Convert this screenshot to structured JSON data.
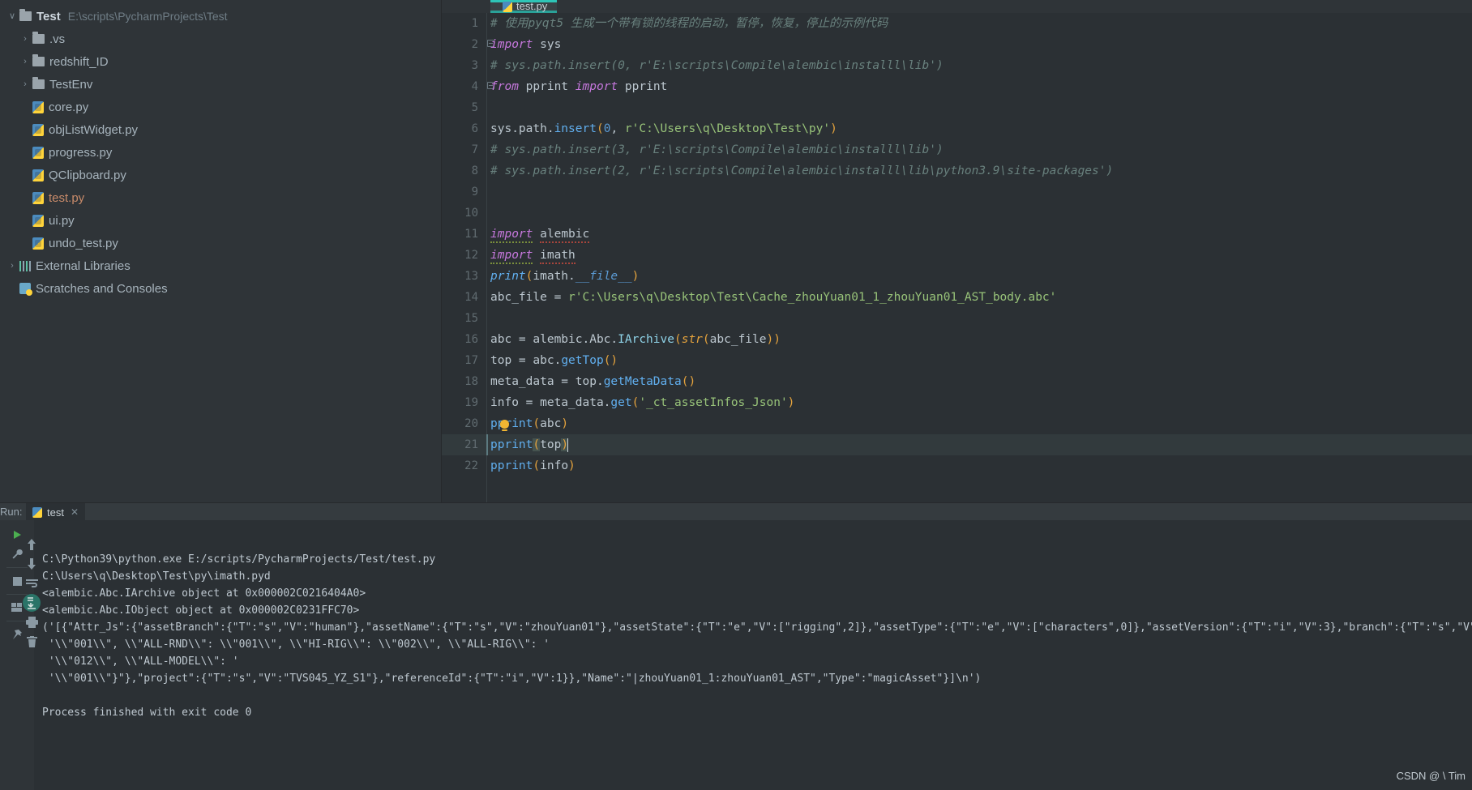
{
  "sidebar": {
    "items": [
      {
        "arrow": "v",
        "icon": "folder-icon",
        "label": "Test",
        "path": "E:\\scripts\\PycharmProjects\\Test",
        "bold": true,
        "indent": 0
      },
      {
        "arrow": ">",
        "icon": "folder-icon",
        "label": ".vs",
        "path": "",
        "bold": false,
        "indent": 1
      },
      {
        "arrow": ">",
        "icon": "folder-icon",
        "label": "redshift_ID",
        "path": "",
        "bold": false,
        "indent": 1
      },
      {
        "arrow": ">",
        "icon": "folder-icon",
        "label": "TestEnv",
        "path": "",
        "bold": false,
        "indent": 1
      },
      {
        "arrow": "",
        "icon": "python-file-icon",
        "label": "core.py",
        "path": "",
        "bold": false,
        "indent": 1
      },
      {
        "arrow": "",
        "icon": "python-file-icon",
        "label": "objListWidget.py",
        "path": "",
        "bold": false,
        "indent": 1
      },
      {
        "arrow": "",
        "icon": "python-file-icon",
        "label": "progress.py",
        "path": "",
        "bold": false,
        "indent": 1
      },
      {
        "arrow": "",
        "icon": "python-file-icon",
        "label": "QClipboard.py",
        "path": "",
        "bold": false,
        "indent": 1
      },
      {
        "arrow": "",
        "icon": "python-file-icon",
        "label": "test.py",
        "path": "",
        "bold": false,
        "indent": 1,
        "highlight": true
      },
      {
        "arrow": "",
        "icon": "python-file-icon",
        "label": "ui.py",
        "path": "",
        "bold": false,
        "indent": 1
      },
      {
        "arrow": "",
        "icon": "python-file-icon",
        "label": "undo_test.py",
        "path": "",
        "bold": false,
        "indent": 1
      },
      {
        "arrow": ">",
        "icon": "external-libraries-icon",
        "label": "External Libraries",
        "path": "",
        "bold": false,
        "indent": 0
      },
      {
        "arrow": "",
        "icon": "scratches-icon",
        "label": "Scratches and Consoles",
        "path": "",
        "bold": false,
        "indent": 0
      }
    ]
  },
  "editor": {
    "tab": {
      "label": "test.py",
      "icon": "python-file-icon"
    },
    "lines": [
      {
        "n": "1",
        "fold": false,
        "html": "<span class='t-cmt'># 使用pyqt5 生成一个带有锁的线程的启动，暂停，恢复，停止的示例代码</span>"
      },
      {
        "n": "2",
        "fold": true,
        "html": "<span class='t-imp'>import</span> <span class='t-plain'>sys</span>"
      },
      {
        "n": "3",
        "fold": false,
        "html": "<span class='t-cmt'># sys.path.insert(0, r'E:\\scripts\\Compile\\alembic\\installl\\lib')</span>"
      },
      {
        "n": "4",
        "fold": true,
        "html": "<span class='t-imp'>from</span> <span class='t-plain'>pprint</span> <span class='t-imp'>import</span> <span class='t-plain'>pprint</span>"
      },
      {
        "n": "5",
        "fold": false,
        "html": ""
      },
      {
        "n": "6",
        "fold": false,
        "html": "<span class='t-plain'>sys.path.</span><span class='t-meth'>insert</span><span class='t-paren'>(</span><span class='t-num'>0</span><span class='t-plain'>, </span><span class='t-str2'>r'C:\\Users\\q\\Desktop\\Test\\py'</span><span class='t-paren'>)</span>"
      },
      {
        "n": "7",
        "fold": false,
        "html": "<span class='t-cmt'># sys.path.insert(3, r'E:\\scripts\\Compile\\alembic\\installl\\lib')</span>"
      },
      {
        "n": "8",
        "fold": false,
        "html": "<span class='t-cmt'># sys.path.insert(2, r'E:\\scripts\\Compile\\alembic\\installl\\lib\\python3.9\\site-packages')</span>"
      },
      {
        "n": "9",
        "fold": false,
        "html": ""
      },
      {
        "n": "10",
        "fold": false,
        "html": ""
      },
      {
        "n": "11",
        "fold": false,
        "html": "<span class='t-imp squig-g'>import</span> <span class='t-plain squig-r'>alembic</span>"
      },
      {
        "n": "12",
        "fold": false,
        "html": "<span class='t-imp squig-g'>import</span> <span class='t-plain squig-r'>imath</span>"
      },
      {
        "n": "13",
        "fold": false,
        "html": "<span class='t-fn'>print</span><span class='t-paren'>(</span><span class='t-plain'>imath.</span><span class='t-dunder'>__file__</span><span class='t-paren'>)</span>"
      },
      {
        "n": "14",
        "fold": false,
        "html": "<span class='t-plain'>abc_file = </span><span class='t-str2'>r'C:\\Users\\q\\Desktop\\Test\\Cache_zhouYuan01_1_zhouYuan01_AST_body.abc'</span>"
      },
      {
        "n": "15",
        "fold": false,
        "html": ""
      },
      {
        "n": "16",
        "fold": false,
        "html": "<span class='t-plain'>abc = alembic.Abc.</span><span class='t-cls'>IArchive</span><span class='t-paren'>(</span><span class='t-builtin'>str</span><span class='t-paren'>(</span><span class='t-plain'>abc_file</span><span class='t-paren'>))</span>"
      },
      {
        "n": "17",
        "fold": false,
        "html": "<span class='t-plain'>top = abc.</span><span class='t-meth'>getTop</span><span class='t-paren'>()</span>"
      },
      {
        "n": "18",
        "fold": false,
        "html": "<span class='t-plain'>meta_data = top.</span><span class='t-meth'>getMetaData</span><span class='t-paren'>()</span>"
      },
      {
        "n": "19",
        "fold": false,
        "html": "<span class='t-plain'>info = meta_data.</span><span class='t-meth'>get</span><span class='t-paren'>(</span><span class='t-str2'>'_ct_assetInfos_Json'</span><span class='t-paren'>)</span>"
      },
      {
        "n": "20",
        "fold": false,
        "bulb": true,
        "html": "<span class='t-meth'>pprint</span><span class='t-paren'>(</span><span class='t-plain'>abc</span><span class='t-paren'>)</span>"
      },
      {
        "n": "21",
        "fold": false,
        "current": true,
        "html": "<span class='t-meth'>pprint</span><span class='t-paren bracket-hl'>(</span><span class='t-plain'>top</span><span class='t-paren bracket-hl'>)</span><span class='caret'></span>"
      },
      {
        "n": "22",
        "fold": false,
        "html": "<span class='t-meth'>pprint</span><span class='t-paren'>(</span><span class='t-plain'>info</span><span class='t-paren'>)</span>"
      }
    ]
  },
  "run_panel": {
    "label": "Run:",
    "tab_label": "test",
    "close_label": "✕",
    "toolbar_icons": [
      "run-icon",
      "wrench-icon",
      "stop-icon",
      "layout-icon",
      "pin-icon"
    ],
    "toolbar_icons_right": [
      "arrow-up-icon",
      "arrow-down-icon",
      "soft-wrap-icon",
      "scroll-to-end-icon",
      "print-icon",
      "trash-icon"
    ],
    "console_lines": [
      "C:\\Python39\\python.exe E:/scripts/PycharmProjects/Test/test.py",
      "C:\\Users\\q\\Desktop\\Test\\py\\imath.pyd",
      "<alembic.Abc.IArchive object at 0x000002C0216404A0>",
      "<alembic.Abc.IObject object at 0x000002C0231FFC70>",
      "('[{\"Attr_Js\":{\"assetBranch\":{\"T\":\"s\",\"V\":\"human\"},\"assetName\":{\"T\":\"s\",\"V\":\"zhouYuan01\"},\"assetState\":{\"T\":\"e\",\"V\":[\"rigging\",2]},\"assetType\":{\"T\":\"e\",\"V\":[\"characters\",0]},\"assetVersion\":{\"T\":\"i\",\"V\":3},\"branch\":{\"T\":\"s\",\"V\":\"NULL\"},\"createDate\":{\"T\"",
      " '\\\\\"001\\\\\", \\\\\"ALL-RND\\\\\": \\\\\"001\\\\\", \\\\\"HI-RIG\\\\\": \\\\\"002\\\\\", \\\\\"ALL-RIG\\\\\": '",
      " '\\\\\"012\\\\\", \\\\\"ALL-MODEL\\\\\": '",
      " '\\\\\"001\\\\\"}\"},\"project\":{\"T\":\"s\",\"V\":\"TVS045_YZ_S1\"},\"referenceId\":{\"T\":\"i\",\"V\":1}},\"Name\":\"|zhouYuan01_1:zhouYuan01_AST\",\"Type\":\"magicAsset\"}]\\n')",
      "",
      "Process finished with exit code 0"
    ]
  },
  "watermark": "CSDN @ \\ Tim",
  "colors": {
    "accent": "#2ec4b6",
    "editor_bg": "#2b3034",
    "sidebar_bg": "#2f3438",
    "current_line": "#323a3d"
  }
}
